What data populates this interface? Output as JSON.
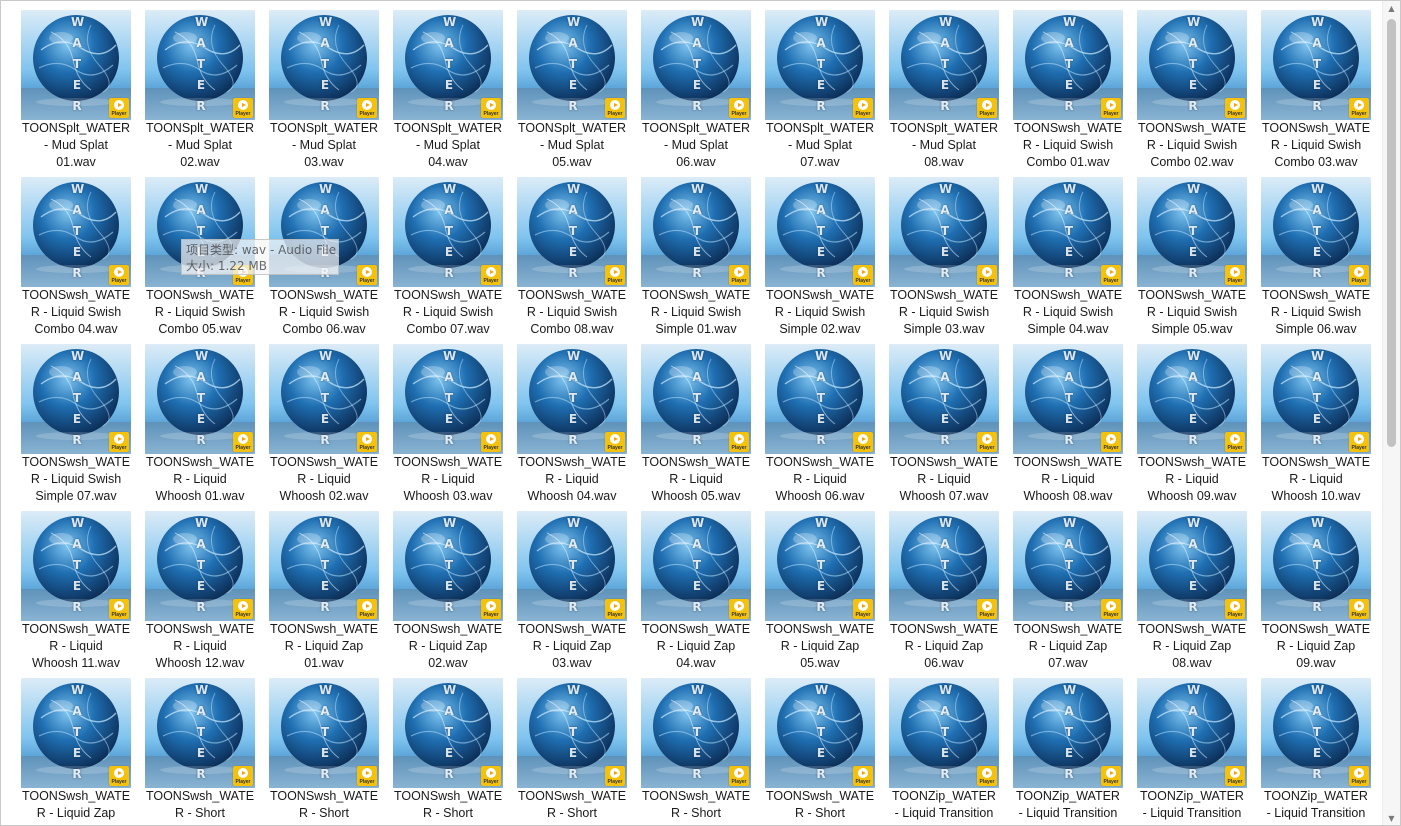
{
  "thumbnail": {
    "letters": [
      "W",
      "A",
      "T",
      "E",
      "R"
    ],
    "badge_label": "Player",
    "badge_color": "#f4c20d",
    "art_colors": [
      "#0b2a52",
      "#1f6fb2",
      "#7fc4ef",
      "#dcecf7"
    ]
  },
  "files": [
    [
      "TOONSplt_WATER",
      "- Mud Splat",
      "01.wav"
    ],
    [
      "TOONSplt_WATER",
      "- Mud Splat",
      "02.wav"
    ],
    [
      "TOONSplt_WATER",
      "- Mud Splat",
      "03.wav"
    ],
    [
      "TOONSplt_WATER",
      "- Mud Splat",
      "04.wav"
    ],
    [
      "TOONSplt_WATER",
      "- Mud Splat",
      "05.wav"
    ],
    [
      "TOONSplt_WATER",
      "- Mud Splat",
      "06.wav"
    ],
    [
      "TOONSplt_WATER",
      "- Mud Splat",
      "07.wav"
    ],
    [
      "TOONSplt_WATER",
      "- Mud Splat",
      "08.wav"
    ],
    [
      "TOONSwsh_WATE",
      "R - Liquid Swish",
      "Combo 01.wav"
    ],
    [
      "TOONSwsh_WATE",
      "R - Liquid Swish",
      "Combo 02.wav"
    ],
    [
      "TOONSwsh_WATE",
      "R - Liquid Swish",
      "Combo 03.wav"
    ],
    [
      "TOONSwsh_WATE",
      "R - Liquid Swish",
      "Combo 04.wav"
    ],
    [
      "TOONSwsh_WATE",
      "R - Liquid Swish",
      "Combo 05.wav"
    ],
    [
      "TOONSwsh_WATE",
      "R - Liquid Swish",
      "Combo 06.wav"
    ],
    [
      "TOONSwsh_WATE",
      "R - Liquid Swish",
      "Combo 07.wav"
    ],
    [
      "TOONSwsh_WATE",
      "R - Liquid Swish",
      "Combo 08.wav"
    ],
    [
      "TOONSwsh_WATE",
      "R - Liquid Swish",
      "Simple 01.wav"
    ],
    [
      "TOONSwsh_WATE",
      "R - Liquid Swish",
      "Simple 02.wav"
    ],
    [
      "TOONSwsh_WATE",
      "R - Liquid Swish",
      "Simple 03.wav"
    ],
    [
      "TOONSwsh_WATE",
      "R - Liquid Swish",
      "Simple 04.wav"
    ],
    [
      "TOONSwsh_WATE",
      "R - Liquid Swish",
      "Simple 05.wav"
    ],
    [
      "TOONSwsh_WATE",
      "R - Liquid Swish",
      "Simple 06.wav"
    ],
    [
      "TOONSwsh_WATE",
      "R - Liquid Swish",
      "Simple 07.wav"
    ],
    [
      "TOONSwsh_WATE",
      "R - Liquid",
      "Whoosh 01.wav"
    ],
    [
      "TOONSwsh_WATE",
      "R - Liquid",
      "Whoosh 02.wav"
    ],
    [
      "TOONSwsh_WATE",
      "R - Liquid",
      "Whoosh 03.wav"
    ],
    [
      "TOONSwsh_WATE",
      "R - Liquid",
      "Whoosh 04.wav"
    ],
    [
      "TOONSwsh_WATE",
      "R - Liquid",
      "Whoosh 05.wav"
    ],
    [
      "TOONSwsh_WATE",
      "R - Liquid",
      "Whoosh 06.wav"
    ],
    [
      "TOONSwsh_WATE",
      "R - Liquid",
      "Whoosh 07.wav"
    ],
    [
      "TOONSwsh_WATE",
      "R - Liquid",
      "Whoosh 08.wav"
    ],
    [
      "TOONSwsh_WATE",
      "R - Liquid",
      "Whoosh 09.wav"
    ],
    [
      "TOONSwsh_WATE",
      "R - Liquid",
      "Whoosh 10.wav"
    ],
    [
      "TOONSwsh_WATE",
      "R - Liquid",
      "Whoosh 11.wav"
    ],
    [
      "TOONSwsh_WATE",
      "R - Liquid",
      "Whoosh 12.wav"
    ],
    [
      "TOONSwsh_WATE",
      "R - Liquid Zap",
      "01.wav"
    ],
    [
      "TOONSwsh_WATE",
      "R - Liquid Zap",
      "02.wav"
    ],
    [
      "TOONSwsh_WATE",
      "R - Liquid Zap",
      "03.wav"
    ],
    [
      "TOONSwsh_WATE",
      "R - Liquid Zap",
      "04.wav"
    ],
    [
      "TOONSwsh_WATE",
      "R - Liquid Zap",
      "05.wav"
    ],
    [
      "TOONSwsh_WATE",
      "R - Liquid Zap",
      "06.wav"
    ],
    [
      "TOONSwsh_WATE",
      "R - Liquid Zap",
      "07.wav"
    ],
    [
      "TOONSwsh_WATE",
      "R - Liquid Zap",
      "08.wav"
    ],
    [
      "TOONSwsh_WATE",
      "R - Liquid Zap",
      "09.wav"
    ],
    [
      "TOONSwsh_WATE",
      "R - Liquid Zap",
      ""
    ],
    [
      "TOONSwsh_WATE",
      "R - Short",
      ""
    ],
    [
      "TOONSwsh_WATE",
      "R - Short",
      ""
    ],
    [
      "TOONSwsh_WATE",
      "R - Short",
      ""
    ],
    [
      "TOONSwsh_WATE",
      "R - Short",
      ""
    ],
    [
      "TOONSwsh_WATE",
      "R - Short",
      ""
    ],
    [
      "TOONSwsh_WATE",
      "R - Short",
      ""
    ],
    [
      "TOONZip_WATER",
      "- Liquid Transition",
      ""
    ],
    [
      "TOONZip_WATER",
      "- Liquid Transition",
      ""
    ],
    [
      "TOONZip_WATER",
      "- Liquid Transition",
      ""
    ],
    [
      "TOONZip_WATER",
      "- Liquid Transition",
      ""
    ]
  ],
  "tooltip": {
    "line1": "项目类型: wav - Audio File",
    "line2": "大小: 1.22 MB"
  },
  "scrollbar": {
    "up_glyph": "▲",
    "down_glyph": "▼"
  }
}
